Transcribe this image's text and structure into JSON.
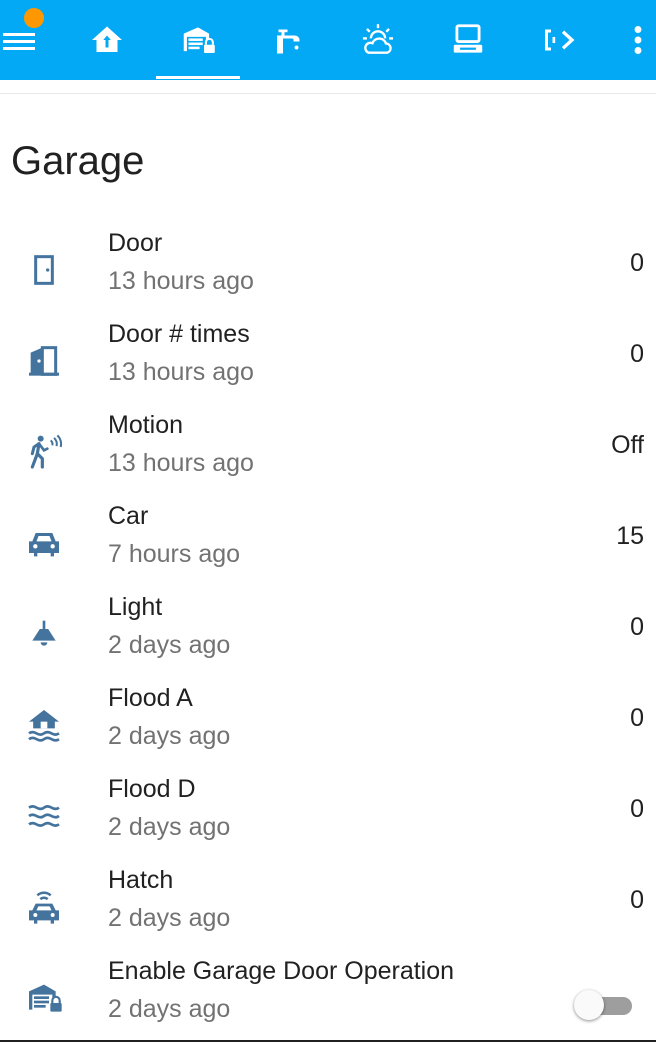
{
  "colors": {
    "header": "#03a9f4",
    "icon": "#44739e",
    "badge": "#ff9800",
    "primary_text": "#212121",
    "secondary_text": "#727272"
  },
  "header": {
    "menu_icon": "menu-icon",
    "tabs": [
      {
        "icon": "home-icon",
        "active": false
      },
      {
        "icon": "garage-lock-icon",
        "active": true
      },
      {
        "icon": "faucet-icon",
        "active": false
      },
      {
        "icon": "weather-partly-cloudy-icon",
        "active": false
      },
      {
        "icon": "laptop-icon",
        "active": false
      },
      {
        "icon": "tab-overflow-icon",
        "active": false
      }
    ],
    "more_icon": "dots-vertical-icon"
  },
  "card": {
    "title": "Garage",
    "entities": [
      {
        "icon": "door-icon",
        "name": "Door",
        "time": "13 hours ago",
        "value": "0"
      },
      {
        "icon": "door-open-icon",
        "name": "Door # times",
        "time": "13 hours ago",
        "value": "0"
      },
      {
        "icon": "motion-sensor-icon",
        "name": "Motion",
        "time": "13 hours ago",
        "value": "Off"
      },
      {
        "icon": "car-icon",
        "name": "Car",
        "time": "7 hours ago",
        "value": "15"
      },
      {
        "icon": "ceiling-light-icon",
        "name": "Light",
        "time": "2 days ago",
        "value": "0"
      },
      {
        "icon": "home-flood-icon",
        "name": "Flood A",
        "time": "2 days ago",
        "value": "0"
      },
      {
        "icon": "waves-icon",
        "name": "Flood D",
        "time": "2 days ago",
        "value": "0"
      },
      {
        "icon": "car-connected-icon",
        "name": "Hatch",
        "time": "2 days ago",
        "value": "0"
      },
      {
        "icon": "garage-lock-icon",
        "name": "Enable Garage Door Operation",
        "time": "2 days ago",
        "toggle": "off"
      }
    ]
  }
}
